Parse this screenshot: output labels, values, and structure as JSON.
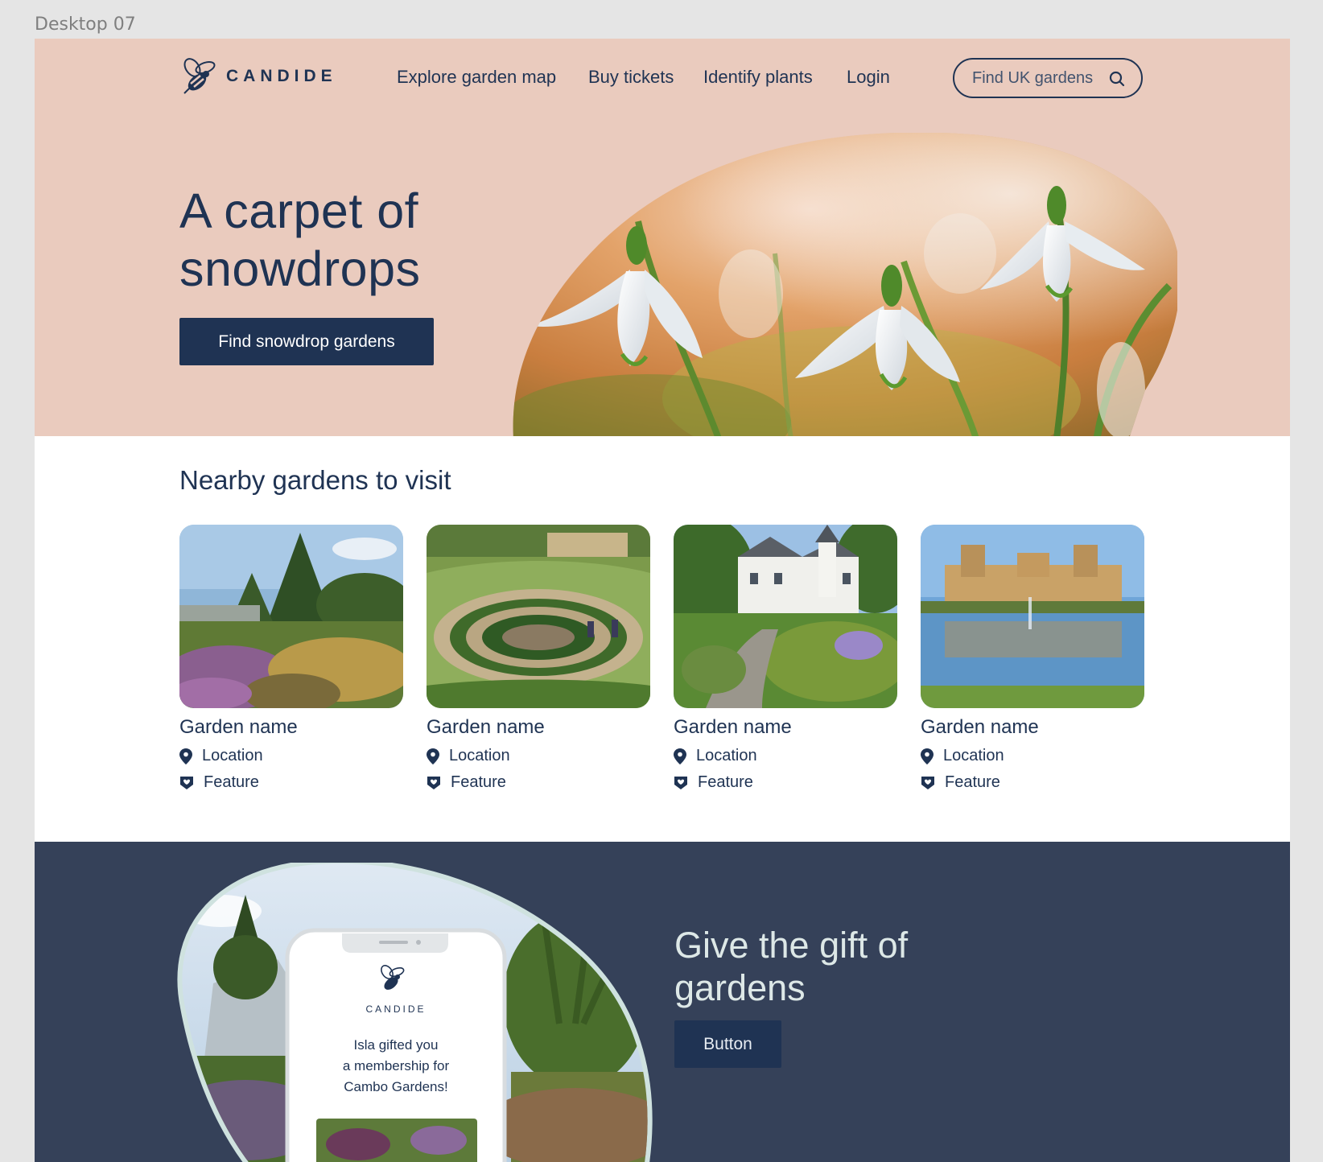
{
  "frame_label": "Desktop 07",
  "brand": {
    "name": "CANDIDE",
    "logo_icon": "bee-icon"
  },
  "nav": {
    "items": [
      "Explore garden map",
      "Buy tickets",
      "Identify plants",
      "Login"
    ],
    "search_label": "Find UK gardens",
    "search_icon": "search-icon"
  },
  "hero": {
    "title_line1": "A carpet of",
    "title_line2": "snowdrops",
    "cta": "Find snowdrop gardens",
    "image": "snowdrop-flowers-photo"
  },
  "nearby": {
    "title": "Nearby gardens to visit",
    "cards": [
      {
        "name": "Garden name",
        "location": "Location",
        "feature": "Feature",
        "image": "woodland-garden-photo"
      },
      {
        "name": "Garden name",
        "location": "Location",
        "feature": "Feature",
        "image": "walled-garden-terraces-photo"
      },
      {
        "name": "Garden name",
        "location": "Location",
        "feature": "Feature",
        "image": "castle-garden-photo"
      },
      {
        "name": "Garden name",
        "location": "Location",
        "feature": "Feature",
        "image": "palace-water-garden-photo"
      }
    ],
    "location_icon": "map-pin-icon",
    "feature_icon": "shield-badge-icon"
  },
  "gift": {
    "title_line1": "Give the gift of",
    "title_line2": "gardens",
    "button": "Button",
    "phone": {
      "brand": "CANDIDE",
      "message_line1": "Isla gifted you",
      "message_line2": "a membership for",
      "message_line3": "Cambo Gardens!"
    }
  },
  "colors": {
    "navy": "#1f3353",
    "hero_bg": "#eacbbe",
    "gift_bg": "#354159",
    "gift_text": "#dde8e7"
  }
}
